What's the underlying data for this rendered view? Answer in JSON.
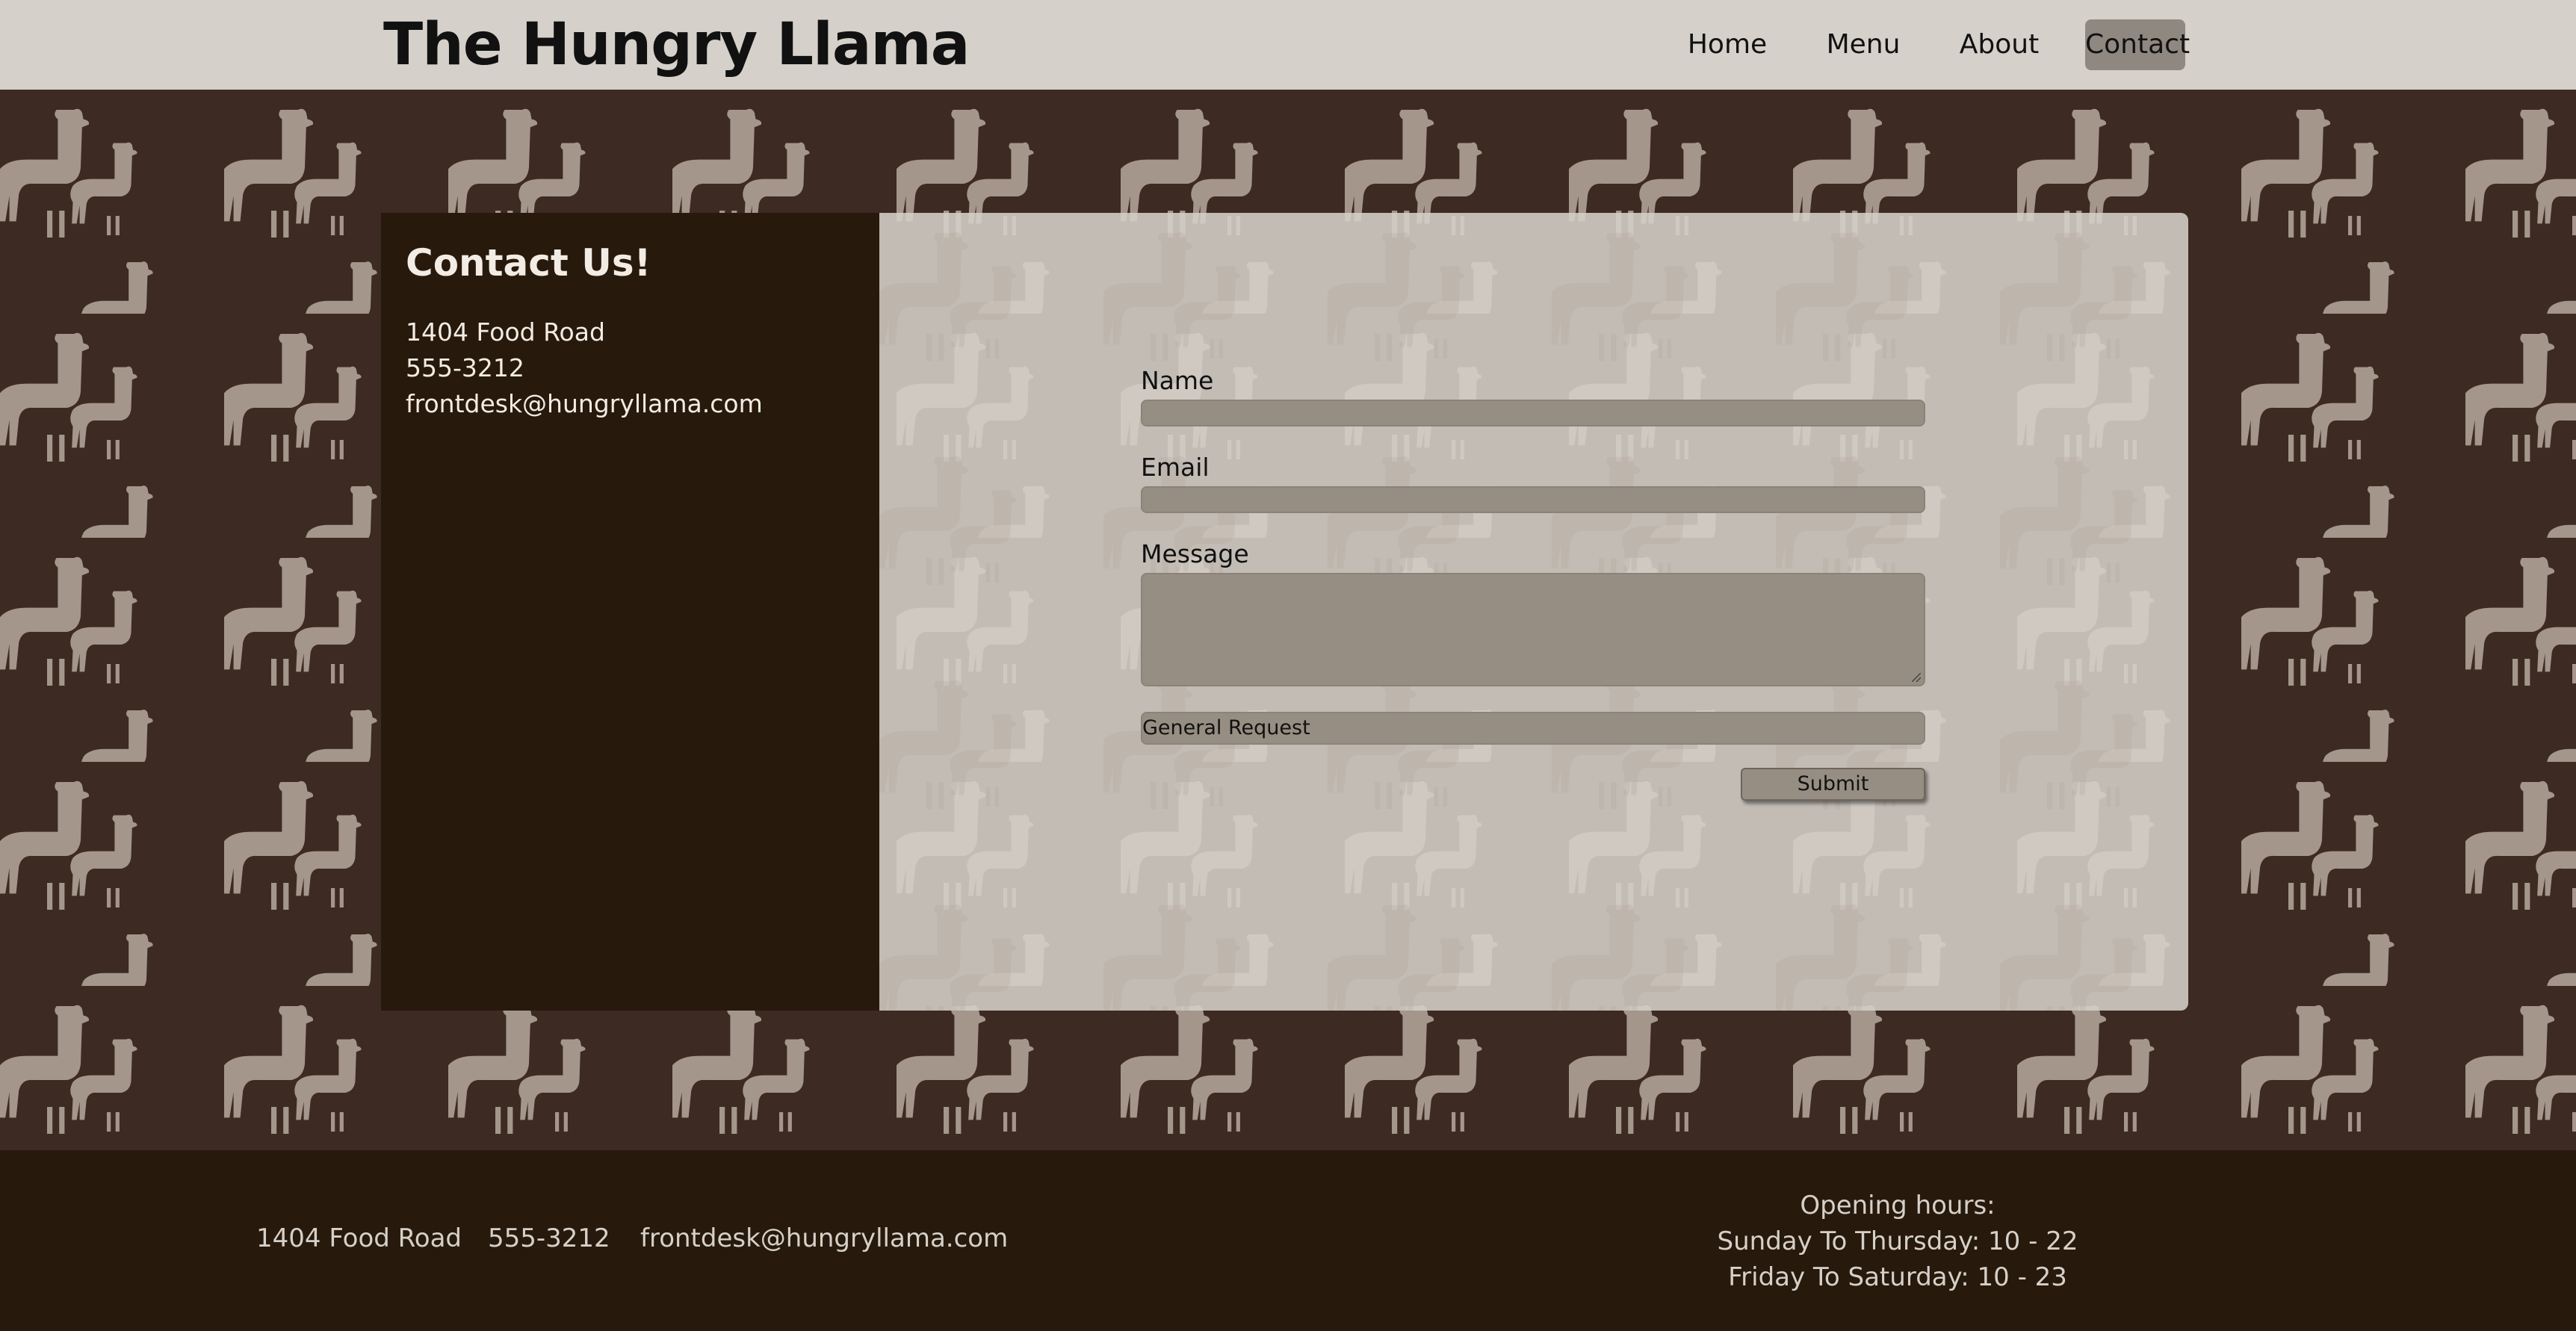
{
  "header": {
    "title": "The Hungry Llama",
    "nav": [
      {
        "label": "Home",
        "active": false
      },
      {
        "label": "Menu",
        "active": false
      },
      {
        "label": "About",
        "active": false
      },
      {
        "label": "Contact",
        "active": true
      }
    ]
  },
  "contact": {
    "heading": "Contact Us!",
    "address": "1404 Food Road",
    "phone": "555-3212",
    "email": "frontdesk@hungryllama.com"
  },
  "form": {
    "name_label": "Name",
    "name_value": "",
    "email_label": "Email",
    "email_value": "",
    "message_label": "Message",
    "message_value": "",
    "request_type": "General Request",
    "submit_label": "Submit"
  },
  "footer": {
    "address": "1404 Food Road",
    "phone": "555-3212",
    "email": "frontdesk@hungryllama.com",
    "hours_title": "Opening hours:",
    "hours_weekday": "Sunday To Thursday: 10 - 22",
    "hours_weekend": "Friday To Saturday: 10 - 23"
  },
  "colors": {
    "header_bg": "#d5d0c9",
    "page_bg": "#3c2a23",
    "panel_dark": "#27190b",
    "field_bg": "#978e83",
    "llama": "#b6a99c"
  },
  "icons": {
    "background_pattern": "llama-icon",
    "thumbnail": "preview-thumbnail"
  }
}
